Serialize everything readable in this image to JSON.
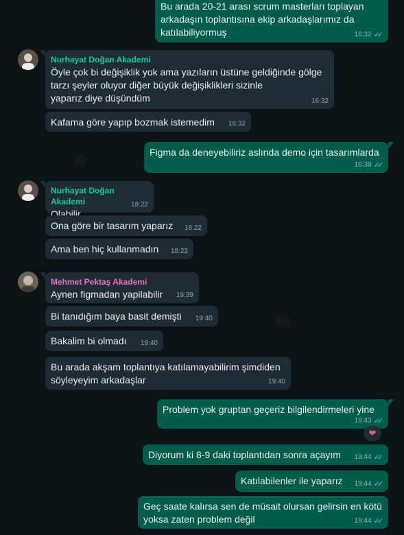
{
  "colors": {
    "incoming": "#202c33",
    "outgoing": "#005c4b",
    "sender_green": "#06cf9c",
    "sender_pink": "#ec6ac8",
    "read_tick": "#53bdeb"
  },
  "messages": [
    {
      "dir": "out",
      "text": "Bu arada 20-21 arası scrum masterları toplayan\narkadaşın toplantısına ekip arkadaşlarımız da\nkatılabiliyormuş",
      "time": "16:32",
      "read": true
    },
    {
      "dir": "in",
      "sender": "Nurhayat Doğan Akademi",
      "text": "Öyle çok bi değişiklik yok ama yazıların üstüne geldiğinde gölge\ntarzı şeyler oluyor diğer büyük değişiklikleri sizinle\nyaparız diye düşündüm",
      "time": "16:32"
    },
    {
      "dir": "in",
      "text": "Kafama göre yapıp bozmak istemedim",
      "time": "16:32"
    },
    {
      "dir": "out",
      "text": "Figma da deneyebiliriz aslında demo için tasarımlarda",
      "time": "16:38",
      "read": true
    },
    {
      "dir": "in",
      "sender": "Nurhayat Doğan Akademi",
      "text": "Olabilir",
      "time": "18:22"
    },
    {
      "dir": "in",
      "text": "Ona göre bir tasarım yaparız",
      "time": "18:22"
    },
    {
      "dir": "in",
      "text": "Ama ben hiç kullanmadın",
      "time": "18:22"
    },
    {
      "dir": "in",
      "sender": "Mehmet Pektaş Akademi",
      "text": "Aynen figmadan yapilabilir",
      "time": "19:39"
    },
    {
      "dir": "in",
      "text": "Bi tanıdığım baya basit demişti",
      "time": "19:40"
    },
    {
      "dir": "in",
      "text": "Bakalim bi olmadı",
      "time": "19:40"
    },
    {
      "dir": "in",
      "text": "Bu arada akşam toplantıya katılamayabilirim şimdiden\nsöyleyeyim arkadaşlar",
      "time": "19:40"
    },
    {
      "dir": "out",
      "text": "Problem yok gruptan geçeriz bilgilendirmeleri yine",
      "time": "19:43",
      "read": true,
      "reaction": "❤"
    },
    {
      "dir": "out",
      "text": "Diyorum ki 8-9 daki toplantıdan sonra açayım",
      "time": "19:44",
      "read": true
    },
    {
      "dir": "out",
      "text": "Katılabilenler ile yaparız",
      "time": "19:44",
      "read": true
    },
    {
      "dir": "out",
      "text": "Geç saate kalırsa sen de müsait olursan gelirsin en kötü\nyoksa zaten problem değil",
      "time": "19:44",
      "read": true
    }
  ],
  "tick_glyph": "✓✓"
}
